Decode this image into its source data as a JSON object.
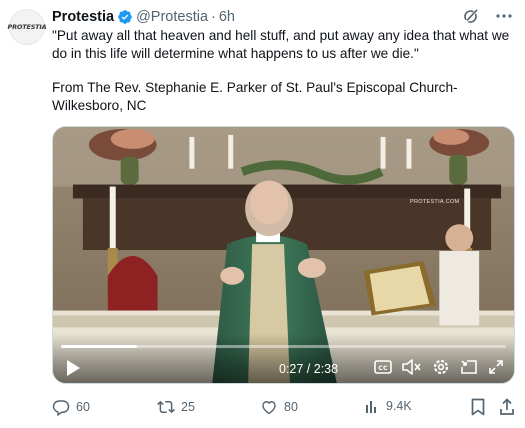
{
  "post": {
    "avatar_text": "PROTESTIA",
    "author_name": "Protestia",
    "handle": "@Protestia",
    "separator": "·",
    "time": "6h",
    "text_line1": "\"Put away all that heaven and hell stuff, and put away any idea that what we do in this life will determine what happens to us after we die.\"",
    "text_line2": "From The Rev. Stephanie E. Parker of St. Paul's Episcopal Church-Wilkesboro, NC"
  },
  "video": {
    "watermark": "PROTESTIA.COM",
    "current_time": "0:27",
    "duration": "2:38",
    "time_display": "0:27 / 2:38",
    "progress": 0.171
  },
  "actions": {
    "replies": "60",
    "reposts": "25",
    "likes": "80",
    "views": "9.4K"
  },
  "colors": {
    "verified_blue": "#1d9bf0",
    "text_secondary": "#536471",
    "text_primary": "#0f1419"
  },
  "icons": [
    "verified-badge-icon",
    "grok-icon",
    "more-icon",
    "play-icon",
    "captions-icon",
    "volume-muted-icon",
    "settings-icon",
    "pip-icon",
    "fullscreen-icon",
    "reply-icon",
    "repost-icon",
    "like-icon",
    "views-icon",
    "bookmark-icon",
    "share-icon"
  ]
}
